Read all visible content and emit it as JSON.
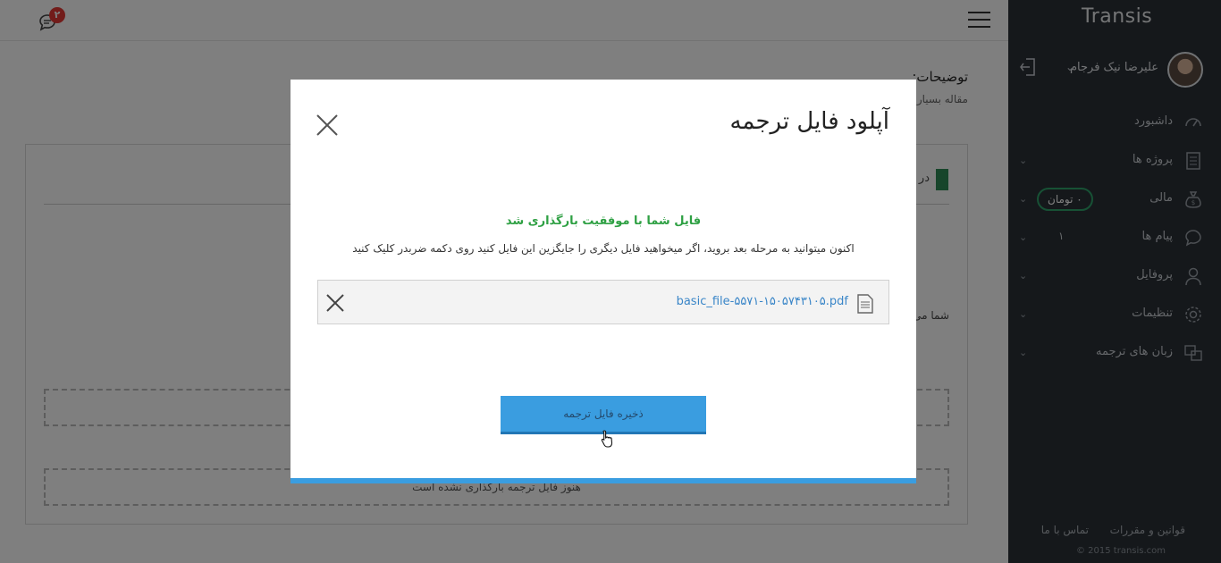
{
  "sidebar": {
    "logo_text": "Transis",
    "user_name": "علیرضا نیک فرجام",
    "nav": [
      {
        "label": "داشبورد",
        "icon": "dashboard-icon"
      },
      {
        "label": "پروژه ها",
        "icon": "document-icon"
      },
      {
        "label": "مالی",
        "icon": "money-bag-icon",
        "badge": "۰ تومان"
      },
      {
        "label": "پیام ها",
        "icon": "chat-icon",
        "count": "۱"
      },
      {
        "label": "پروفایل",
        "icon": "user-icon"
      },
      {
        "label": "تنظیمات",
        "icon": "gear-icon"
      },
      {
        "label": "زبان های ترجمه",
        "icon": "translate-icon"
      }
    ],
    "footer": {
      "rules": "قوانین و مقررات",
      "contact": "تماس با ما",
      "copyright": "© 2015 transis.com"
    }
  },
  "header": {
    "notification_count": "۲"
  },
  "main": {
    "description_label": "توضیحات:",
    "description_text": "مقاله بسیار",
    "panel_head": "در",
    "panel_line": "شما می",
    "no_file_text": "هنوز فایل ترجمه بارگذاری نشده است"
  },
  "modal": {
    "title": "آپلود فایل ترجمه",
    "success_message": "فایل شما با موفقیت بارگذاری شد",
    "info_message": "اکنون میتوانید به مرحله بعد بروید، اگر میخواهید فایل دیگری را جایگزین این فایل کنید روی دکمه ضربدر کلیک کنید",
    "file_name": "basic_file-۵۵۷۱-۱۵۰۵۷۴۳۱۰۵.pdf",
    "save_button": "ذخیره فایل ترجمه"
  },
  "colors": {
    "accent": "#3a9de0",
    "success": "#2ea043",
    "sidebar": "#2a3037",
    "badge": "#e53935"
  }
}
